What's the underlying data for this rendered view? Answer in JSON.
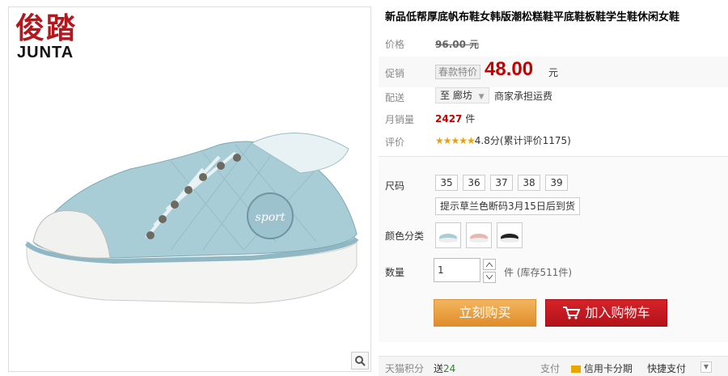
{
  "brand": {
    "name_cn": "俊踏",
    "name_en": "JUNTA"
  },
  "product": {
    "title": "新品低帮厚底帆布鞋女韩版潮松糕鞋平底鞋板鞋学生鞋休闲女鞋"
  },
  "price": {
    "label": "价格",
    "original": "96.00",
    "unit": "元"
  },
  "promo": {
    "label": "促销",
    "badge": "春款特价",
    "price": "48.00",
    "unit": "元"
  },
  "shipping": {
    "label": "配送",
    "destination": "至 廊坊",
    "note": "商家承担运费"
  },
  "sales": {
    "label": "月销量",
    "count": "2427",
    "unit": "件"
  },
  "rating": {
    "label": "评价",
    "stars": "★★★★★",
    "score_text": "4.8分(累计评价1175)"
  },
  "size": {
    "label": "尺码",
    "options": [
      "35",
      "36",
      "37",
      "38",
      "39"
    ],
    "hint": "提示草兰色断码3月15日后到货"
  },
  "color": {
    "label": "颜色分类",
    "swatches": [
      "light-blue",
      "pink",
      "black"
    ]
  },
  "quantity": {
    "label": "数量",
    "value": "1",
    "unit": "件",
    "stock": "(库存511件)"
  },
  "actions": {
    "buy_now": "立刻购买",
    "add_cart": "加入购物车"
  },
  "footer": {
    "points_label": "天猫积分",
    "points_value": "送",
    "points_amount": "24",
    "pay_label": "支付",
    "credit_card": "信用卡分期",
    "quick_pay": "快捷支付"
  },
  "colors": {
    "price_red": "#c40000",
    "buy_orange": "#e89a3c",
    "cart_red": "#c41a21",
    "shoe_blue": "#a9cdd6"
  },
  "icons": [
    "zoom-icon",
    "cart-icon",
    "chevron-down-icon",
    "arrow-up-icon",
    "arrow-down-icon",
    "credit-card-icon"
  ]
}
